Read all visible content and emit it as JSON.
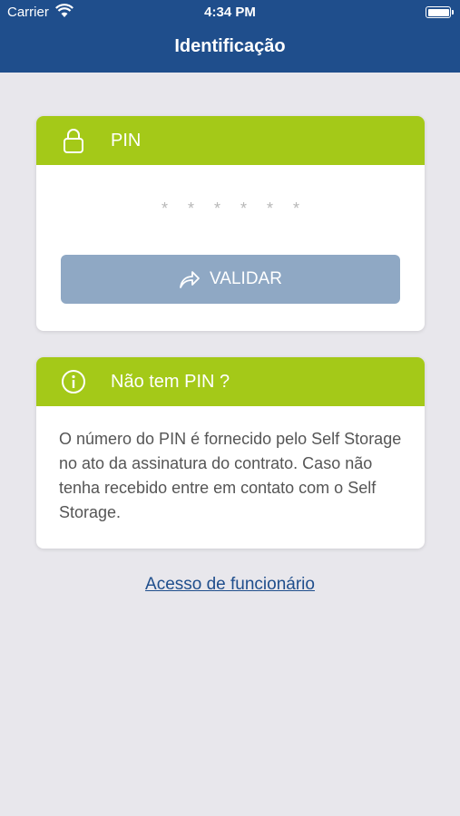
{
  "status_bar": {
    "carrier": "Carrier",
    "time": "4:34 PM"
  },
  "header": {
    "title": "Identificação",
    "background": "#1f4e8c"
  },
  "pin_card": {
    "header_label": "PIN",
    "header_icon": "lock-icon",
    "pin_mask": "******",
    "validate_label": "VALIDAR",
    "validate_icon": "share-arrow-icon",
    "accent": "#a4c918",
    "button_color": "#8fa8c4"
  },
  "info_card": {
    "header_label": "Não tem PIN ?",
    "header_icon": "info-icon",
    "text": "O número do PIN é fornecido pelo Self Storage no ato da assinatura do contrato. Caso não tenha recebido entre em contato com o Self Storage."
  },
  "footer": {
    "staff_link": "Acesso de funcionário"
  }
}
